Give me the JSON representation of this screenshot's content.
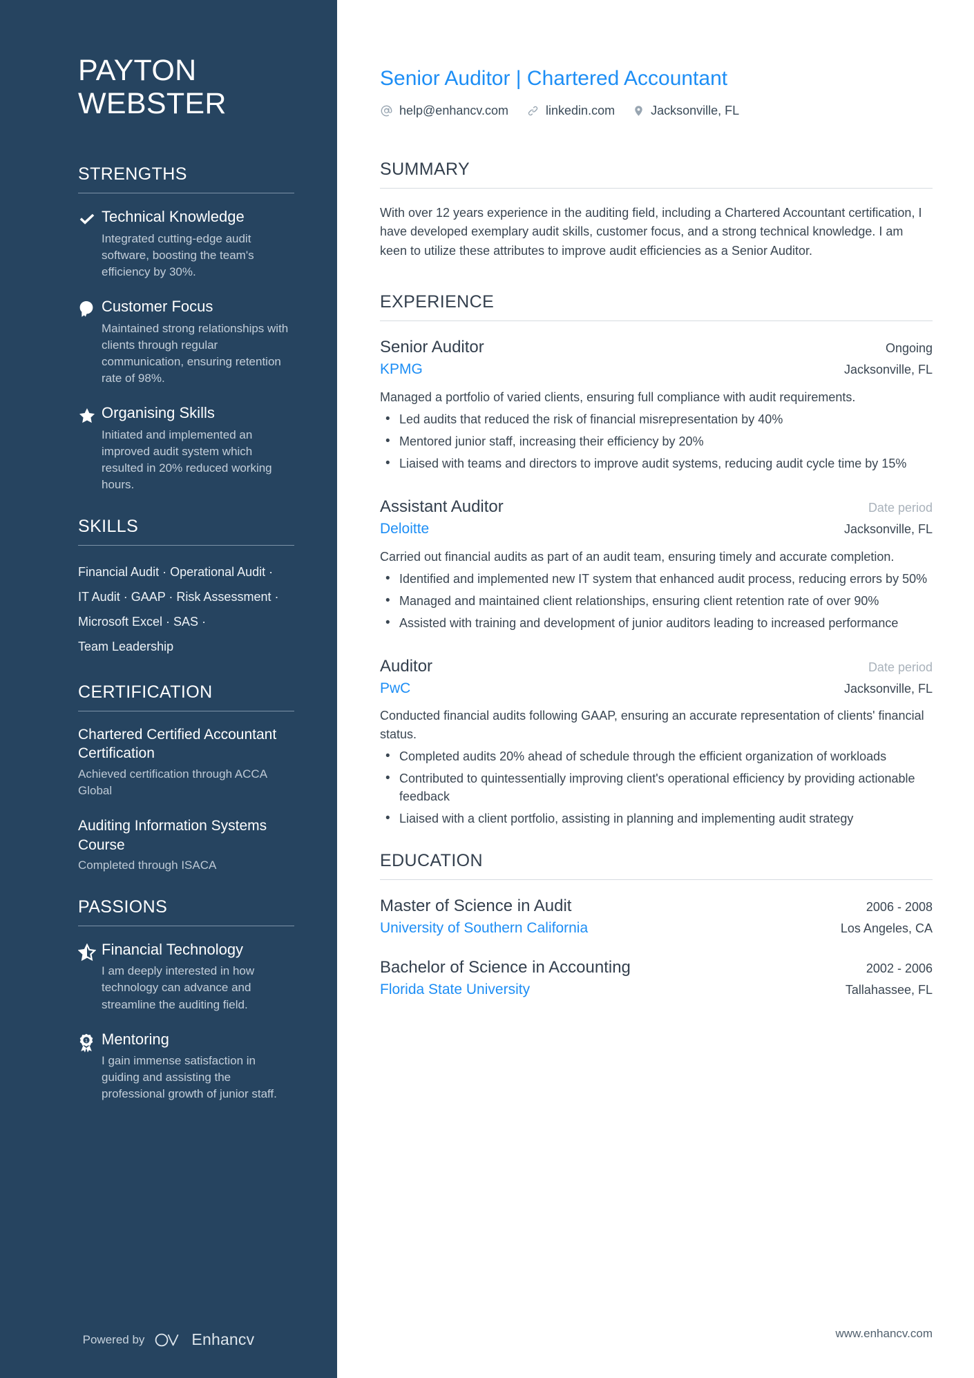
{
  "sidebar": {
    "name_line1": "PAYTON",
    "name_line2": "WEBSTER",
    "strengths_heading": "STRENGTHS",
    "strengths": [
      {
        "icon": "check-icon",
        "title": "Technical Knowledge",
        "desc": "Integrated cutting-edge audit software, boosting the team's efficiency by 30%."
      },
      {
        "icon": "head-profile-icon",
        "title": "Customer Focus",
        "desc": "Maintained strong relationships with clients through regular communication, ensuring retention rate of 98%."
      },
      {
        "icon": "star-icon",
        "title": "Organising Skills",
        "desc": "Initiated and implemented an improved audit system which resulted in 20% reduced working hours."
      }
    ],
    "skills_heading": "SKILLS",
    "skills": [
      "Financial Audit",
      "Operational Audit",
      "IT Audit",
      "GAAP",
      "Risk Assessment",
      "Microsoft Excel",
      "SAS",
      "Team Leadership"
    ],
    "skills_separator": "·",
    "certification_heading": "CERTIFICATION",
    "certifications": [
      {
        "title": "Chartered Certified Accountant Certification",
        "desc": "Achieved certification through ACCA Global"
      },
      {
        "title": "Auditing Information Systems Course",
        "desc": "Completed through ISACA"
      }
    ],
    "passions_heading": "PASSIONS",
    "passions": [
      {
        "icon": "half-star-icon",
        "title": "Financial Technology",
        "desc": "I am deeply interested in how technology can advance and streamline the auditing field."
      },
      {
        "icon": "award-ribbon-icon",
        "title": "Mentoring",
        "desc": "I gain immense satisfaction in guiding and assisting the professional growth of junior staff."
      }
    ],
    "powered_by_label": "Powered by",
    "brand_name": "Enhancv",
    "brand_logo_icon": "enhancv-logo-icon"
  },
  "main": {
    "headline": "Senior Auditor | Chartered Accountant",
    "contacts": [
      {
        "icon": "at-icon",
        "text": "help@enhancv.com"
      },
      {
        "icon": "link-icon",
        "text": "linkedin.com"
      },
      {
        "icon": "map-pin-icon",
        "text": "Jacksonville, FL"
      }
    ],
    "summary_heading": "SUMMARY",
    "summary_text": "With over 12 years experience in the auditing field, including a Chartered Accountant certification, I have developed exemplary audit skills, customer focus, and a strong technical knowledge. I am keen to utilize these attributes to improve audit efficiencies as a Senior Auditor.",
    "experience_heading": "EXPERIENCE",
    "experience": [
      {
        "title": "Senior Auditor",
        "organization": "KPMG",
        "date": "Ongoing",
        "date_is_placeholder": false,
        "location": "Jacksonville, FL",
        "desc": "Managed a portfolio of varied clients, ensuring full compliance with audit requirements.",
        "bullets": [
          "Led audits that reduced the risk of financial misrepresentation by 40%",
          "Mentored junior staff, increasing their efficiency by 20%",
          "Liaised with teams and directors to improve audit systems, reducing audit cycle time by 15%"
        ]
      },
      {
        "title": "Assistant Auditor",
        "organization": "Deloitte",
        "date": "Date period",
        "date_is_placeholder": true,
        "location": "Jacksonville, FL",
        "desc": "Carried out financial audits as part of an audit team, ensuring timely and accurate completion.",
        "bullets": [
          "Identified and implemented new IT system that enhanced audit process, reducing errors by 50%",
          "Managed and maintained client relationships, ensuring client retention rate of over 90%",
          "Assisted with training and development of junior auditors leading to increased performance"
        ]
      },
      {
        "title": "Auditor",
        "organization": "PwC",
        "date": "Date period",
        "date_is_placeholder": true,
        "location": "Jacksonville, FL",
        "desc": "Conducted financial audits following GAAP, ensuring an accurate representation of clients' financial status.",
        "bullets": [
          "Completed audits 20% ahead of schedule through the efficient organization of workloads",
          "Contributed to quintessentially improving client's operational efficiency by providing actionable feedback",
          "Liaised with a client portfolio, assisting in planning and implementing audit strategy"
        ]
      }
    ],
    "education_heading": "EDUCATION",
    "education": [
      {
        "degree": "Master of Science in Audit",
        "school": "University of Southern California",
        "date": "2006 - 2008",
        "location": "Los Angeles, CA"
      },
      {
        "degree": "Bachelor of Science in Accounting",
        "school": "Florida State University",
        "date": "2002 - 2006",
        "location": "Tallahassee, FL"
      }
    ],
    "website": "www.enhancv.com"
  },
  "colors": {
    "sidebar_bg": "#264460",
    "accent_blue": "#1d8ef5",
    "heading_dark": "#333f4d",
    "placeholder_gray": "#a9b2bb"
  }
}
